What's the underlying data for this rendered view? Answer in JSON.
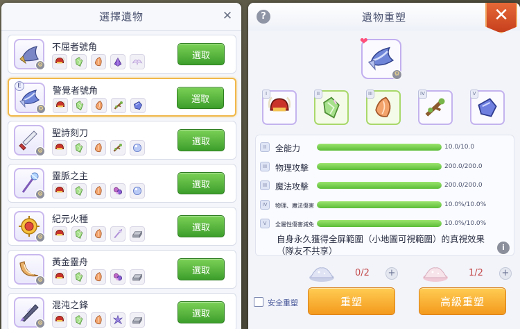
{
  "left_panel": {
    "title": "選擇遺物",
    "close_icon": "close-icon",
    "select_label": "選取",
    "relics": [
      {
        "name": "不屈者號角",
        "icon": "horn-icon",
        "selected": false,
        "badge": "",
        "materials": [
          "helmet-material",
          "green-crystal-material",
          "orange-shard-material",
          "purple-orb-material",
          "wing-material"
        ]
      },
      {
        "name": "警覺者號角",
        "icon": "horn-blue-icon",
        "selected": true,
        "badge": "E",
        "materials": [
          "helmet-material",
          "green-crystal-material",
          "orange-shard-material",
          "branch-material",
          "blue-gem-material"
        ]
      },
      {
        "name": "聖詩刻刀",
        "icon": "dagger-icon",
        "selected": false,
        "badge": "",
        "materials": [
          "helmet-material",
          "green-crystal-material",
          "orange-shard-material",
          "branch-material",
          "blue-orb-material"
        ]
      },
      {
        "name": "靈脈之主",
        "icon": "staff-icon",
        "selected": false,
        "badge": "",
        "materials": [
          "helmet-material",
          "green-crystal-material",
          "orange-shard-material",
          "purple-flower-material",
          "blue-orb-material"
        ]
      },
      {
        "name": "紀元火種",
        "icon": "sun-orb-icon",
        "selected": false,
        "badge": "",
        "materials": [
          "helmet-material",
          "green-crystal-material",
          "orange-shard-material",
          "wand-material",
          "silver-bar-material"
        ]
      },
      {
        "name": "黃金靈舟",
        "icon": "boat-icon",
        "selected": false,
        "badge": "",
        "materials": [
          "helmet-material",
          "green-crystal-material",
          "orange-shard-material",
          "purple-flower-material",
          "silver-bar-material"
        ]
      },
      {
        "name": "混沌之鋒",
        "icon": "blade-icon",
        "selected": false,
        "badge": "",
        "materials": [
          "helmet-material",
          "green-crystal-material",
          "orange-shard-material",
          "purple-splash-material",
          "silver-bar-material"
        ]
      }
    ]
  },
  "right_panel": {
    "title": "遺物重塑",
    "help_label": "?",
    "close_label": "✕",
    "main_relic_icon": "horn-blue-icon",
    "stages": [
      {
        "roman": "I",
        "icon": "helmet-material",
        "active": false
      },
      {
        "roman": "II",
        "icon": "green-crystal-material",
        "active": true
      },
      {
        "roman": "III",
        "icon": "orange-shard-material",
        "active": true
      },
      {
        "roman": "IV",
        "icon": "branch-material",
        "active": false
      },
      {
        "roman": "V",
        "icon": "blue-gem-material",
        "active": false
      }
    ],
    "stats": [
      {
        "level": "II",
        "name": "全能力",
        "value": "10.0/10.0",
        "fill": 1.0,
        "small": false
      },
      {
        "level": "III",
        "name": "物理攻擊",
        "value": "200.0/200.0",
        "fill": 1.0,
        "small": false
      },
      {
        "level": "III",
        "name": "魔法攻擊",
        "value": "200.0/200.0",
        "fill": 1.0,
        "small": false
      },
      {
        "level": "IV",
        "name": "物理、魔法傷害",
        "value": "10.0%/10.0%",
        "fill": 1.0,
        "small": true
      },
      {
        "level": "V",
        "name": "全屬性傷害減免",
        "value": "10.0%/10.0%",
        "fill": 1.0,
        "small": true
      }
    ],
    "effect_text": "自身永久獲得全屏範圍（小地圖可視範圍）的真視效果（隊友不共享）",
    "info_label": "i",
    "costs": [
      {
        "count": "0/2",
        "plus": "+"
      },
      {
        "count": "1/2",
        "plus": "+"
      }
    ],
    "safe_reforge_label": "安全重塑",
    "reforge_label": "重塑",
    "advanced_reforge_label": "高級重塑",
    "colors": {
      "accent_green": "#5bbd37",
      "button_orange": "#f39a1d",
      "close_red": "#d9542a",
      "selected_border": "#f0b84a"
    }
  }
}
